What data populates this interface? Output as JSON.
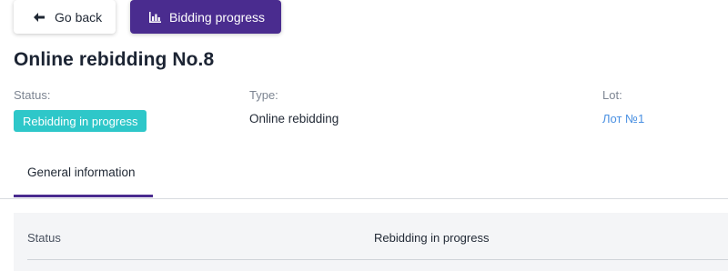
{
  "toolbar": {
    "back_label": "Go back",
    "progress_label": "Bidding progress"
  },
  "page": {
    "title": "Online rebidding No.8"
  },
  "fields": {
    "status_label": "Status:",
    "status_value": "Rebidding in progress",
    "type_label": "Type:",
    "type_value": "Online rebidding",
    "lot_label": "Lot:",
    "lot_value": "Лот №1"
  },
  "tabs": [
    {
      "label": "General information",
      "active": true
    }
  ],
  "general_info": {
    "rows": [
      {
        "key": "Status",
        "value": "Rebidding in progress"
      }
    ]
  },
  "colors": {
    "brand_purple": "#4a2c8f",
    "status_teal": "#2ec7c9",
    "link_blue": "#4a90e2"
  },
  "icons": {
    "back": "arrow-left-icon",
    "progress": "bar-chart-icon"
  }
}
